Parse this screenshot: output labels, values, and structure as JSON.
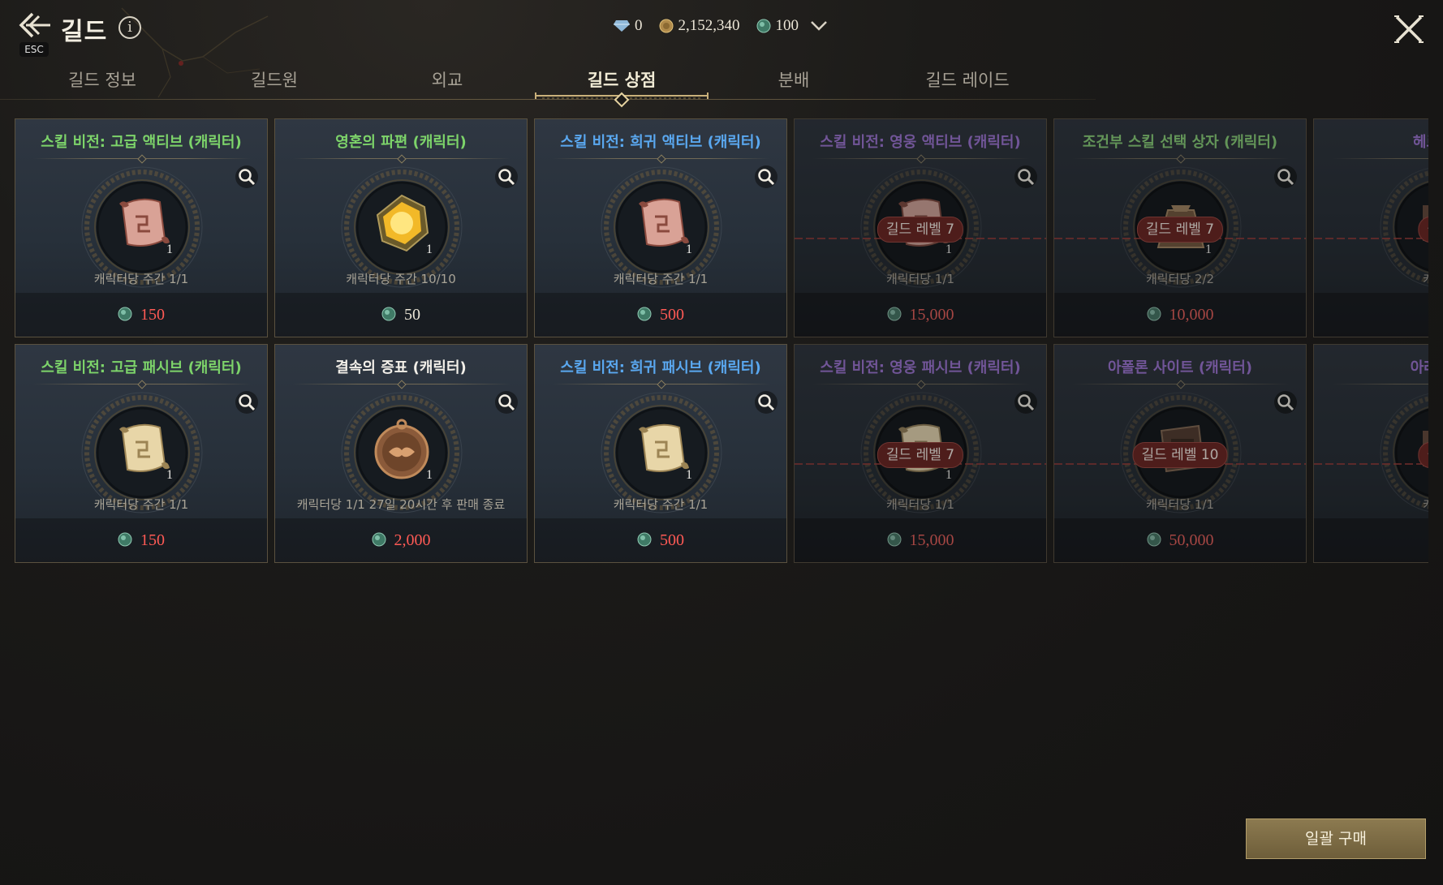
{
  "header": {
    "title": "길드",
    "esc_label": "ESC",
    "info_icon": "i",
    "currencies": [
      {
        "icon": "diamond-icon",
        "value": "0"
      },
      {
        "icon": "gold-coin-icon",
        "value": "2,152,340"
      },
      {
        "icon": "guild-coin-icon",
        "value": "100"
      }
    ]
  },
  "tabs": [
    {
      "label": "길드 정보",
      "active": false
    },
    {
      "label": "길드원",
      "active": false
    },
    {
      "label": "외교",
      "active": false
    },
    {
      "label": "길드 상점",
      "active": true
    },
    {
      "label": "분배",
      "active": false
    },
    {
      "label": "길드 레이드",
      "active": false
    }
  ],
  "items": [
    {
      "name": "스킬 비전: 고급 액티브 (캐릭터)",
      "name_color": "#7dd46a",
      "icon": "red-scroll-icon",
      "qty": "1",
      "limit": "캐릭터당 주간 1/1",
      "price": "150",
      "price_color": "#ff5a55",
      "lock": ""
    },
    {
      "name": "영혼의 파편 (캐릭터)",
      "name_color": "#7dd46a",
      "icon": "soul-shard-icon",
      "qty": "1",
      "limit": "캐릭터당 주간 10/10",
      "price": "50",
      "price_color": "#ebe5d6",
      "lock": ""
    },
    {
      "name": "스킬 비전: 희귀 액티브 (캐릭터)",
      "name_color": "#5aa8f0",
      "icon": "red-scroll-icon",
      "qty": "1",
      "limit": "캐릭터당 주간 1/1",
      "price": "500",
      "price_color": "#ff5a55",
      "lock": ""
    },
    {
      "name": "스킬 비전: 영웅 액티브 (캐릭터)",
      "name_color": "#a372e6",
      "icon": "red-scroll-icon",
      "qty": "1",
      "limit": "캐릭터당  1/1",
      "price": "15,000",
      "price_color": "#ff5a55",
      "lock": "길드 레벨 7"
    },
    {
      "name": "조건부 스킬 선택 상자 (캐릭터)",
      "name_color": "#7dd46a",
      "icon": "pouch-icon",
      "qty": "1",
      "limit": "캐릭터당  2/2",
      "price": "10,000",
      "price_color": "#ff5a55",
      "lock": "길드 레벨 7"
    },
    {
      "name": "헤르메스",
      "name_color": "#a372e6",
      "icon": "generic-item-icon",
      "qty": "",
      "limit": "캐릭터",
      "price": "",
      "price_color": "#ff5a55",
      "lock": "길드"
    },
    {
      "name": "스킬 비전: 고급 패시브 (캐릭터)",
      "name_color": "#7dd46a",
      "icon": "tan-scroll-icon",
      "qty": "1",
      "limit": "캐릭터당 주간 1/1",
      "price": "150",
      "price_color": "#ff5a55",
      "lock": ""
    },
    {
      "name": "결속의 증표 (캐릭터)",
      "name_color": "#f2efe8",
      "icon": "handshake-medal-icon",
      "qty": "1",
      "limit": "캐릭터당  1/1 27일 20시간 후 판매 종료",
      "price": "2,000",
      "price_color": "#ff5a55",
      "lock": ""
    },
    {
      "name": "스킬 비전: 희귀 패시브 (캐릭터)",
      "name_color": "#5aa8f0",
      "icon": "tan-scroll-icon",
      "qty": "1",
      "limit": "캐릭터당 주간 1/1",
      "price": "500",
      "price_color": "#ff5a55",
      "lock": ""
    },
    {
      "name": "스킬 비전: 영웅 패시브 (캐릭터)",
      "name_color": "#a372e6",
      "icon": "tan-scroll-icon",
      "qty": "1",
      "limit": "캐릭터당  1/1",
      "price": "15,000",
      "price_color": "#ff5a55",
      "lock": "길드 레벨 7"
    },
    {
      "name": "아폴론 사이트 (캐릭터)",
      "name_color": "#a372e6",
      "icon": "book-icon",
      "qty": "",
      "limit": "캐릭터당  1/1",
      "price": "50,000",
      "price_color": "#ff5a55",
      "lock": "길드 레벨 10"
    },
    {
      "name": "아레스 블",
      "name_color": "#a372e6",
      "icon": "generic-item-icon",
      "qty": "",
      "limit": "캐릭터",
      "price": "",
      "price_color": "#ff5a55",
      "lock": "길드"
    }
  ],
  "bulk_button": "일괄 구매",
  "colors": {
    "accent_gold": "#b39e6a",
    "locked_red": "#7a2421"
  }
}
